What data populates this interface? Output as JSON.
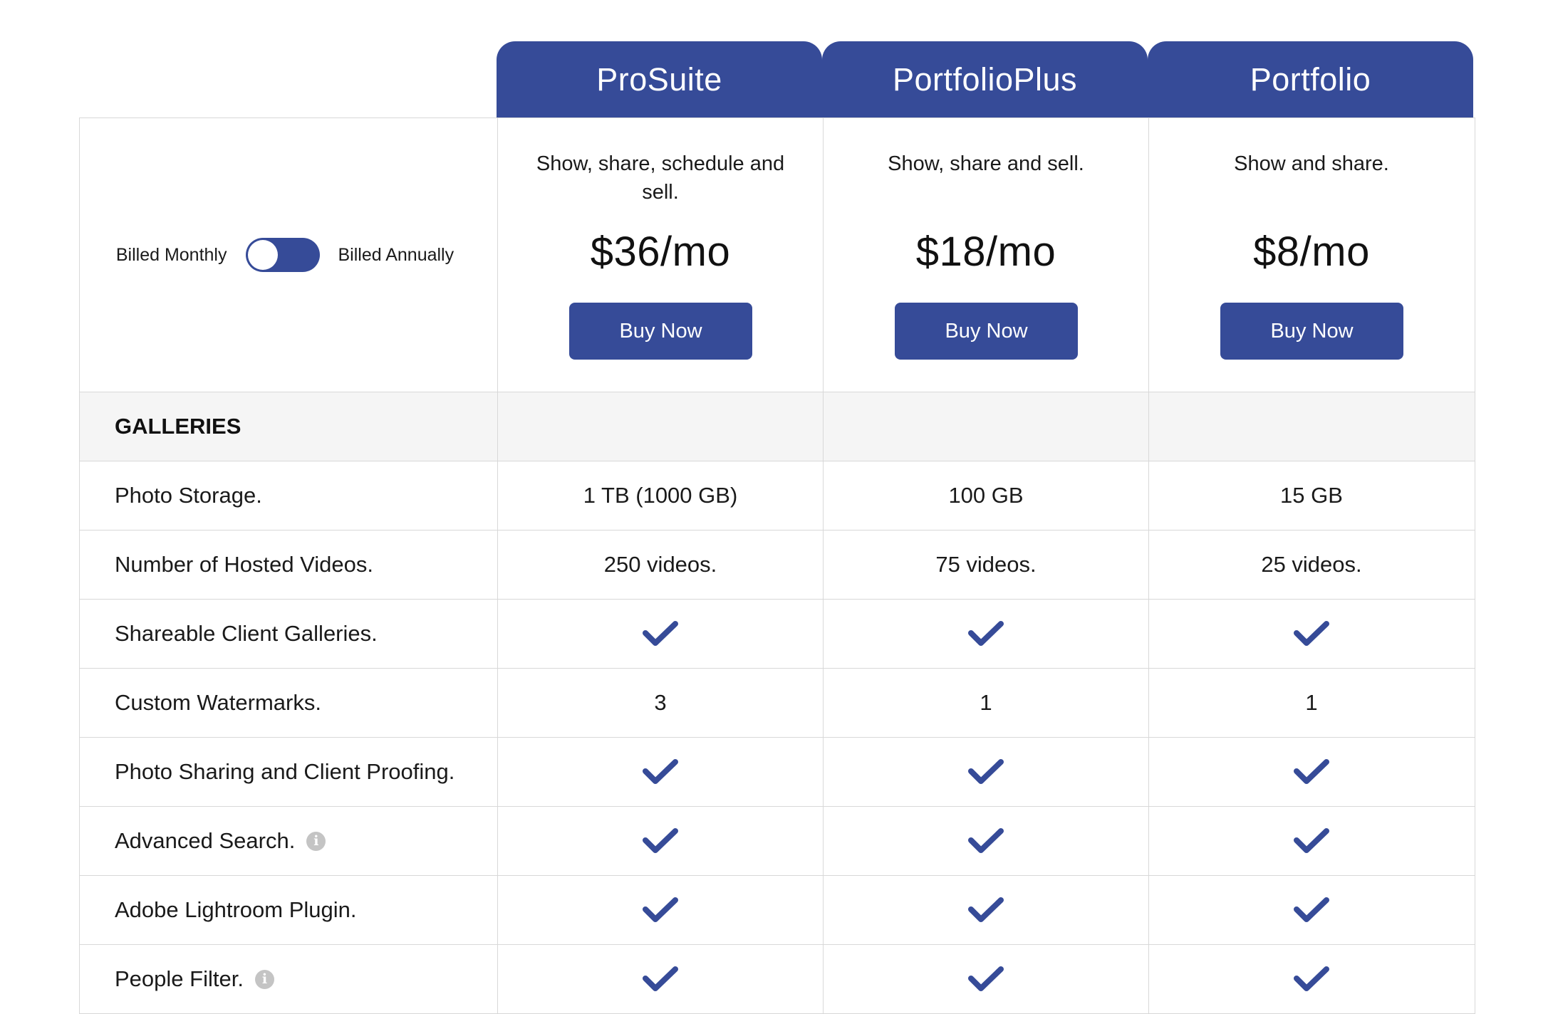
{
  "plans": [
    {
      "name": "ProSuite",
      "tagline": "Show, share, schedule and sell.",
      "price": "$36/mo",
      "buy_label": "Buy Now"
    },
    {
      "name": "PortfolioPlus",
      "tagline": "Show, share and sell.",
      "price": "$18/mo",
      "buy_label": "Buy Now"
    },
    {
      "name": "Portfolio",
      "tagline": "Show and share.",
      "price": "$8/mo",
      "buy_label": "Buy Now"
    }
  ],
  "billing": {
    "monthly_label": "Billed Monthly",
    "annually_label": "Billed Annually",
    "toggle_state": "monthly"
  },
  "section": {
    "title": "GALLERIES"
  },
  "features": [
    {
      "label": "Photo Storage.",
      "info": false,
      "values": [
        "1 TB (1000 GB)",
        "100 GB",
        "15 GB"
      ]
    },
    {
      "label": "Number of Hosted Videos.",
      "info": false,
      "values": [
        "250 videos.",
        "75 videos.",
        "25 videos."
      ]
    },
    {
      "label": "Shareable Client Galleries.",
      "info": false,
      "values": [
        "check",
        "check",
        "check"
      ]
    },
    {
      "label": "Custom Watermarks.",
      "info": false,
      "values": [
        "3",
        "1",
        "1"
      ]
    },
    {
      "label": "Photo Sharing and Client Proofing.",
      "info": false,
      "values": [
        "check",
        "check",
        "check"
      ]
    },
    {
      "label": "Advanced Search.",
      "info": true,
      "values": [
        "check",
        "check",
        "check"
      ]
    },
    {
      "label": "Adobe Lightroom Plugin.",
      "info": false,
      "values": [
        "check",
        "check",
        "check"
      ]
    },
    {
      "label": "People Filter.",
      "info": true,
      "values": [
        "check",
        "check",
        "check"
      ]
    }
  ],
  "icons": {
    "check": "check-icon",
    "info": "info-icon",
    "info_glyph": "i"
  },
  "colors": {
    "brand": "#364b98",
    "section_bg": "#f5f5f5",
    "border": "#d8d8d8",
    "info_icon": "#c4c4c4"
  }
}
